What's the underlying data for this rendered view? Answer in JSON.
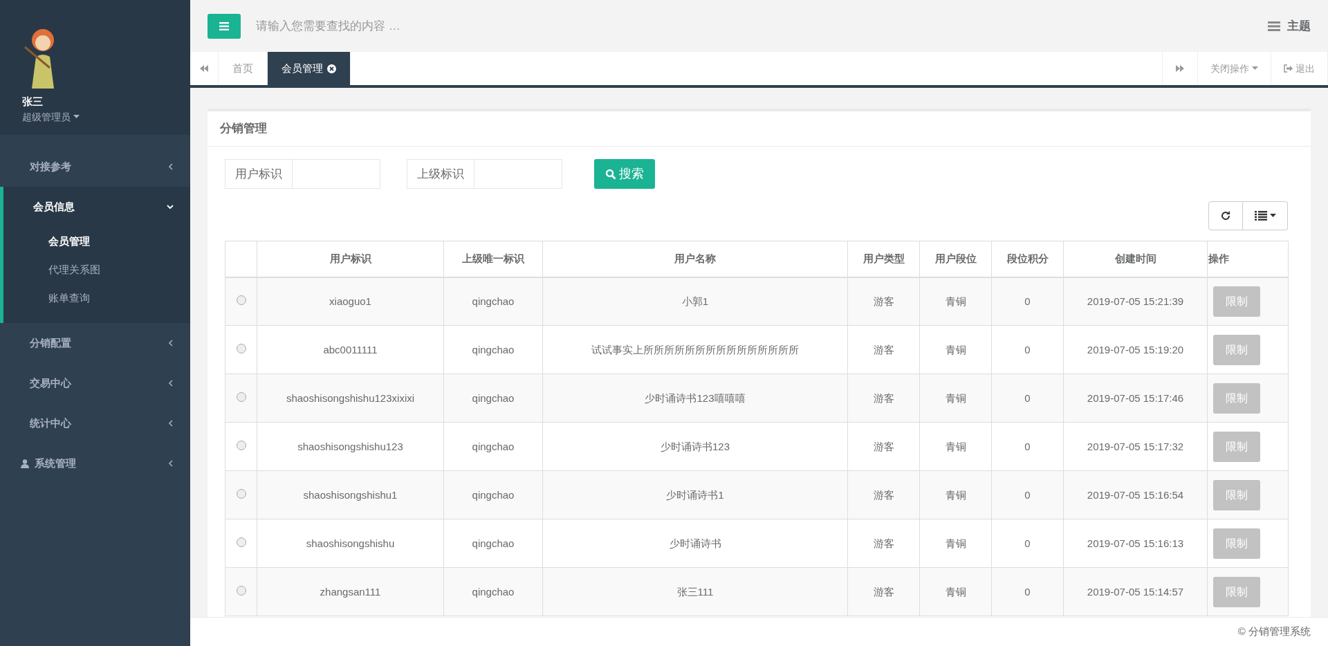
{
  "sidebar": {
    "user": {
      "name": "张三",
      "role": "超级管理员"
    },
    "menu": [
      {
        "label": "对接参考",
        "kind": "plain",
        "expanded": false
      },
      {
        "label": "会员信息",
        "kind": "plain",
        "expanded": true,
        "children": [
          {
            "label": "会员管理",
            "selected": true
          },
          {
            "label": "代理关系图",
            "selected": false
          },
          {
            "label": "账单查询",
            "selected": false
          }
        ]
      },
      {
        "label": "分销配置",
        "kind": "plain",
        "expanded": false
      },
      {
        "label": "交易中心",
        "kind": "plain",
        "expanded": false
      },
      {
        "label": "统计中心",
        "kind": "plain",
        "expanded": false
      },
      {
        "label": "系统管理",
        "kind": "user",
        "expanded": false
      }
    ]
  },
  "topbar": {
    "search": {
      "placeholder": "请输入您需要查找的内容 …"
    },
    "theme": "主题"
  },
  "tabs": [
    {
      "label": "首页",
      "selected": false,
      "closable": false
    },
    {
      "label": "会员管理",
      "selected": true,
      "closable": true
    }
  ],
  "tab_actions": {
    "close_menu": "关闭操作",
    "logout": "退出"
  },
  "card": {
    "title": "分销管理",
    "filters": [
      {
        "label": "用户标识"
      },
      {
        "label": "上级标识"
      }
    ],
    "search_button": "搜索",
    "table": {
      "columns": [
        "用户标识",
        "上级唯一标识",
        "用户名称",
        "用户类型",
        "用户段位",
        "段位积分",
        "创建时间",
        "操作"
      ],
      "rows": [
        {
          "selected": false,
          "cells": [
            "xiaoguo1",
            "qingchao",
            "小郭1",
            "游客",
            "青铜",
            "0",
            "2019-07-05 15:21:39"
          ],
          "action": {
            "label": "限制",
            "disabled": true
          }
        },
        {
          "selected": false,
          "cells": [
            "abc0011111",
            "qingchao",
            "试试事实上所所所所所所所所所所所所所所所",
            "游客",
            "青铜",
            "0",
            "2019-07-05 15:19:20"
          ],
          "action": {
            "label": "限制",
            "disabled": true
          }
        },
        {
          "selected": false,
          "cells": [
            "shaoshisongshishu123xixixi",
            "qingchao",
            "少时诵诗书123嘻嘻嘻",
            "游客",
            "青铜",
            "0",
            "2019-07-05 15:17:46"
          ],
          "action": {
            "label": "限制",
            "disabled": true
          }
        },
        {
          "selected": false,
          "cells": [
            "shaoshisongshishu123",
            "qingchao",
            "少时诵诗书123",
            "游客",
            "青铜",
            "0",
            "2019-07-05 15:17:32"
          ],
          "action": {
            "label": "限制",
            "disabled": true
          }
        },
        {
          "selected": false,
          "cells": [
            "shaoshisongshishu1",
            "qingchao",
            "少时诵诗书1",
            "游客",
            "青铜",
            "0",
            "2019-07-05 15:16:54"
          ],
          "action": {
            "label": "限制",
            "disabled": true
          }
        },
        {
          "selected": false,
          "cells": [
            "shaoshisongshishu",
            "qingchao",
            "少时诵诗书",
            "游客",
            "青铜",
            "0",
            "2019-07-05 15:16:13"
          ],
          "action": {
            "label": "限制",
            "disabled": true
          }
        },
        {
          "selected": false,
          "cells": [
            "zhangsan111",
            "qingchao",
            "张三111",
            "游客",
            "青铜",
            "0",
            "2019-07-05 15:14:57"
          ],
          "action": {
            "label": "限制",
            "disabled": true
          }
        }
      ]
    }
  },
  "footer": "© 分销管理系统"
}
